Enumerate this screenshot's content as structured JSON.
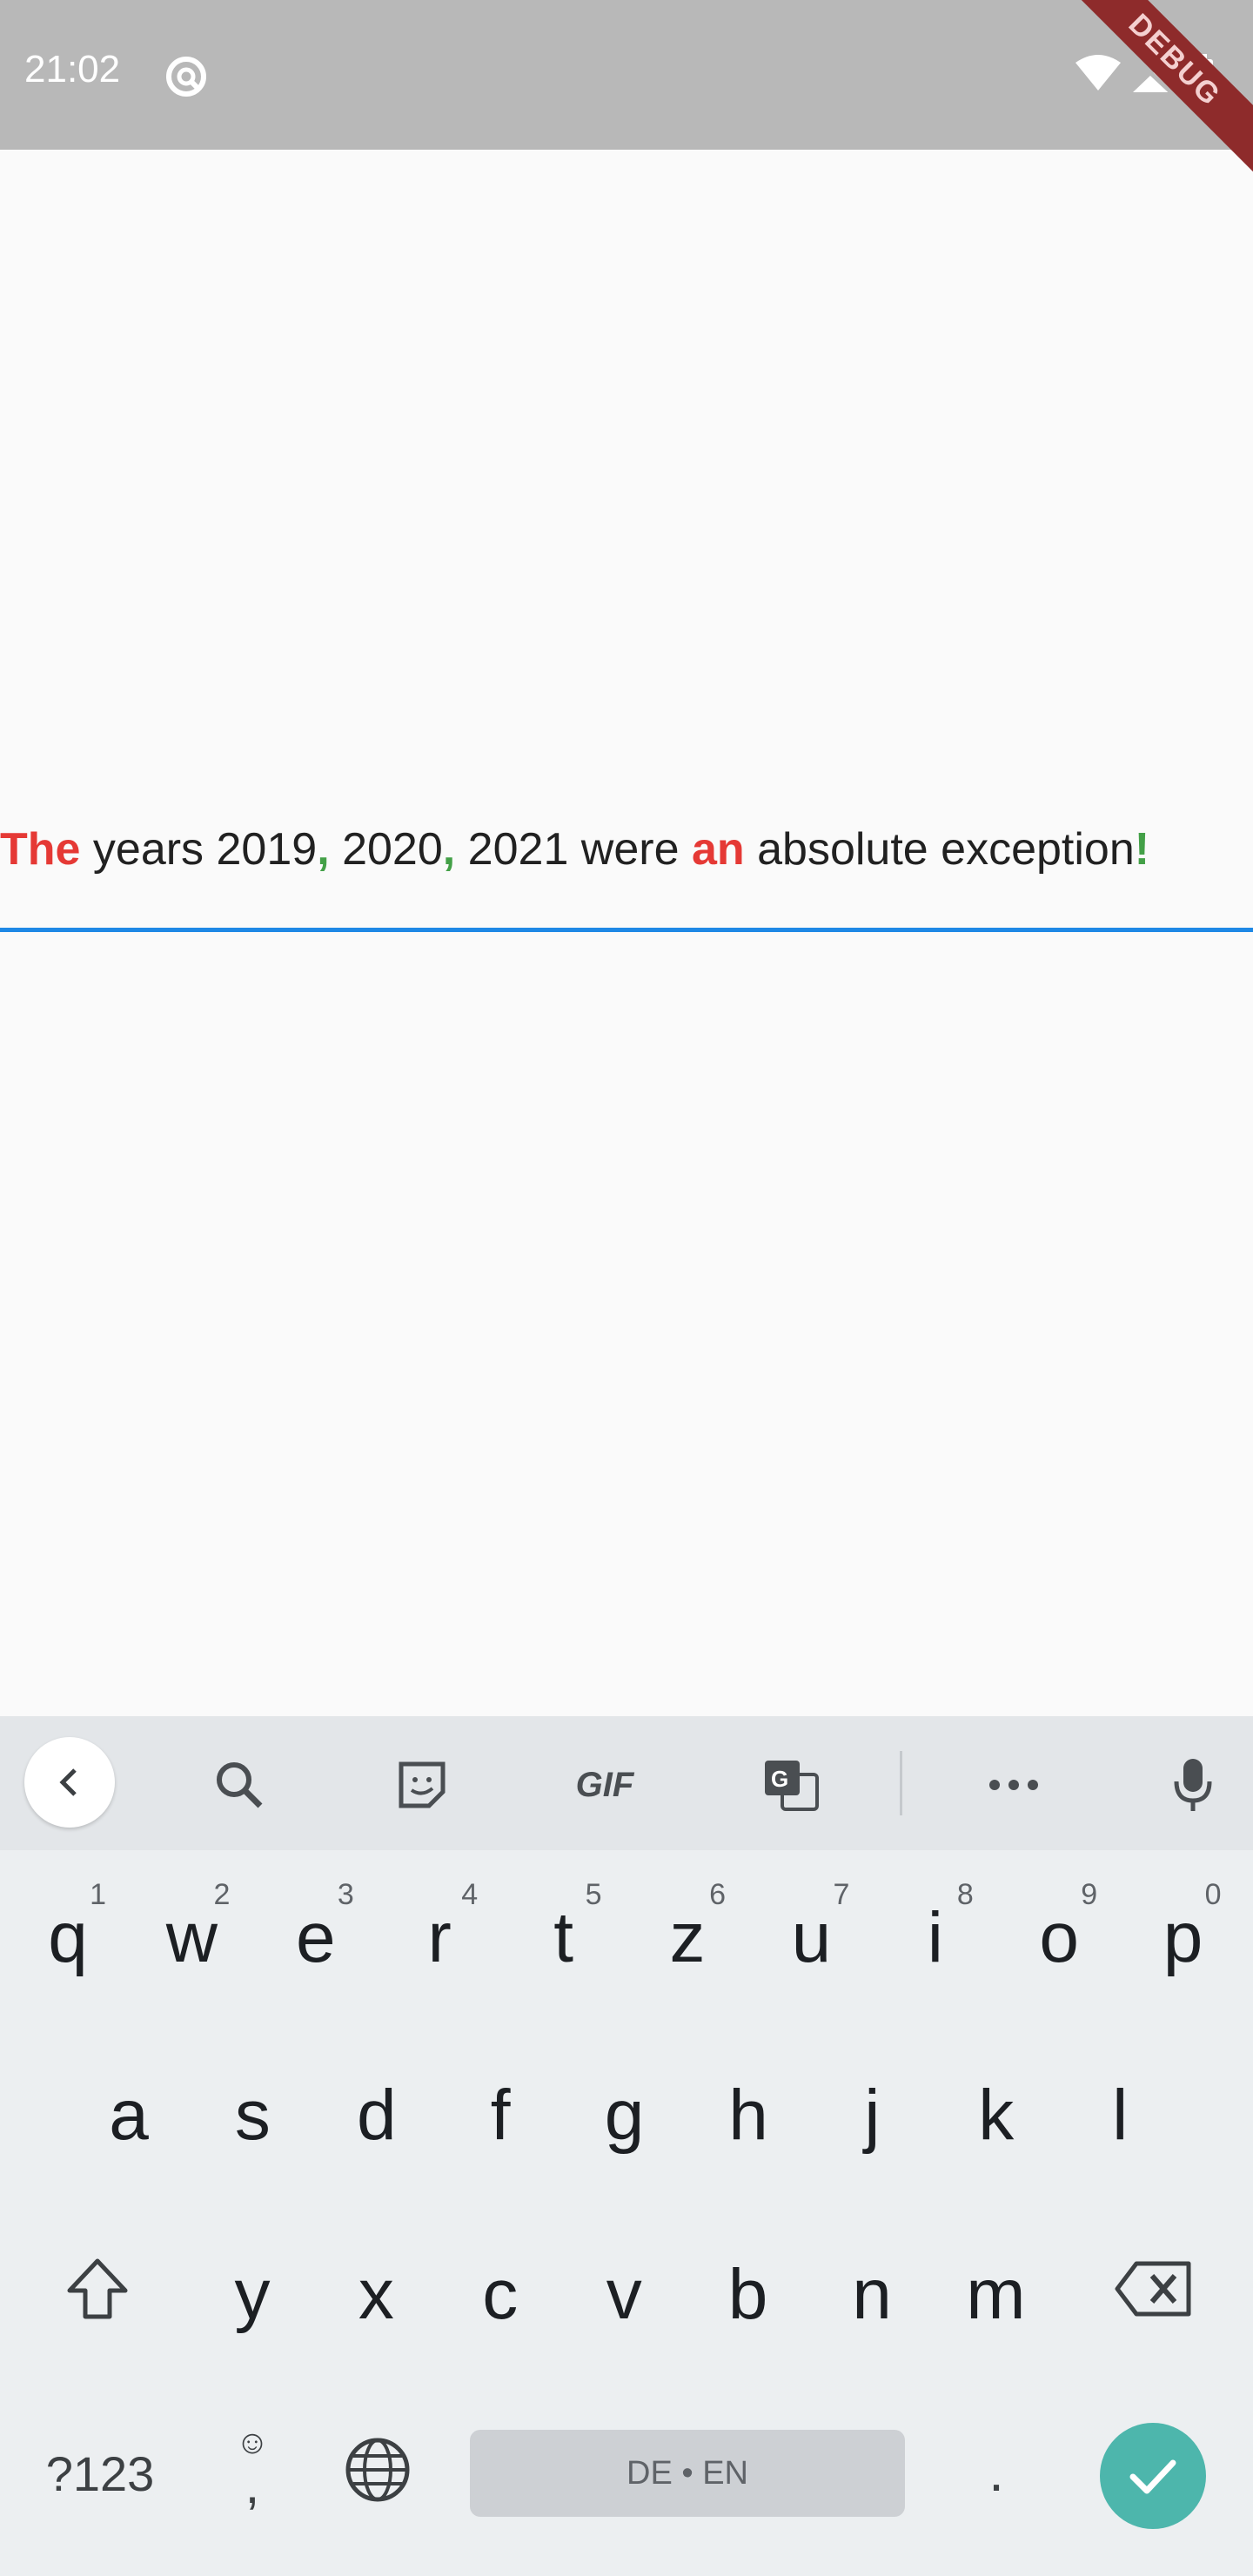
{
  "status_bar": {
    "time": "21:02",
    "debug_label": "DEBUG"
  },
  "editor": {
    "segments": [
      {
        "text": "The",
        "style": "red"
      },
      {
        "text": " years 2019",
        "style": "normal"
      },
      {
        "text": ",",
        "style": "green"
      },
      {
        "text": " 2020",
        "style": "normal"
      },
      {
        "text": ",",
        "style": "green"
      },
      {
        "text": " 2021 were ",
        "style": "normal"
      },
      {
        "text": "an",
        "style": "red"
      },
      {
        "text": " absolute exception",
        "style": "normal"
      },
      {
        "text": "!",
        "style": "green"
      }
    ],
    "colors": {
      "red": "#e53935",
      "green": "#43a047",
      "underline": "#1e88e5"
    }
  },
  "keyboard": {
    "toolbar": [
      "back-icon",
      "search-icon",
      "sticker-icon",
      "gif-button",
      "translate-icon",
      "more-icon",
      "mic-icon"
    ],
    "gif_label": "GIF",
    "row1": [
      {
        "key": "q",
        "hint": "1"
      },
      {
        "key": "w",
        "hint": "2"
      },
      {
        "key": "e",
        "hint": "3"
      },
      {
        "key": "r",
        "hint": "4"
      },
      {
        "key": "t",
        "hint": "5"
      },
      {
        "key": "z",
        "hint": "6"
      },
      {
        "key": "u",
        "hint": "7"
      },
      {
        "key": "i",
        "hint": "8"
      },
      {
        "key": "o",
        "hint": "9"
      },
      {
        "key": "p",
        "hint": "0"
      }
    ],
    "row2": [
      "a",
      "s",
      "d",
      "f",
      "g",
      "h",
      "j",
      "k",
      "l"
    ],
    "row3": [
      "y",
      "x",
      "c",
      "v",
      "b",
      "n",
      "m"
    ],
    "symbols_label": "?123",
    "comma_label": ",",
    "emoji_hint": "☺",
    "space_label": "DE • EN",
    "period_label": ".",
    "enter_color": "#4db6ac"
  }
}
